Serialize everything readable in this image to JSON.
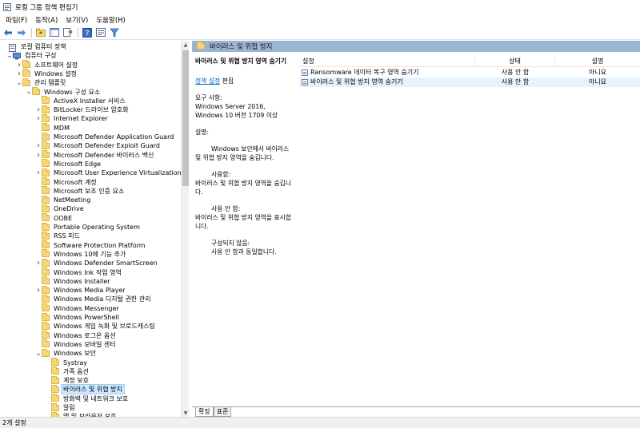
{
  "window": {
    "title": "로컬 그룹 정책 편집기"
  },
  "menu": [
    "파일(F)",
    "동작(A)",
    "보기(V)",
    "도움말(H)"
  ],
  "toolbar": {
    "icons": [
      "back-arrow-icon",
      "forward-arrow-icon",
      "up-folder-icon",
      "show-hide-tree-icon",
      "export-list-icon",
      "help-icon",
      "properties-icon",
      "filter-icon"
    ]
  },
  "tree": [
    {
      "label": "로컬 컴퓨터 정책",
      "indent": 0,
      "exp": "",
      "icon": "policy-icon"
    },
    {
      "label": "컴퓨터 구성",
      "indent": 1,
      "exp": "v",
      "icon": "computer-icon"
    },
    {
      "label": "소프트웨어 설정",
      "indent": 2,
      "exp": ">",
      "icon": "folder-icon"
    },
    {
      "label": "Windows 설정",
      "indent": 2,
      "exp": ">",
      "icon": "folder-icon"
    },
    {
      "label": "관리 템플릿",
      "indent": 2,
      "exp": "v",
      "icon": "folder-icon"
    },
    {
      "label": "Windows 구성 요소",
      "indent": 3,
      "exp": "v",
      "icon": "folder-icon"
    },
    {
      "label": "ActiveX Installer 서비스",
      "indent": 4,
      "exp": "",
      "icon": "folder-icon"
    },
    {
      "label": "BitLocker 드라이브 암호화",
      "indent": 4,
      "exp": ">",
      "icon": "folder-icon"
    },
    {
      "label": "Internet Explorer",
      "indent": 4,
      "exp": ">",
      "icon": "folder-icon"
    },
    {
      "label": "MDM",
      "indent": 4,
      "exp": "",
      "icon": "folder-icon"
    },
    {
      "label": "Microsoft Defender Application Guard",
      "indent": 4,
      "exp": "",
      "icon": "folder-icon"
    },
    {
      "label": "Microsoft Defender Exploit Guard",
      "indent": 4,
      "exp": ">",
      "icon": "folder-icon"
    },
    {
      "label": "Microsoft Defender 바이러스 백신",
      "indent": 4,
      "exp": ">",
      "icon": "folder-icon"
    },
    {
      "label": "Microsoft Edge",
      "indent": 4,
      "exp": "",
      "icon": "folder-icon"
    },
    {
      "label": "Microsoft User Experience Virtualization",
      "indent": 4,
      "exp": ">",
      "icon": "folder-icon"
    },
    {
      "label": "Microsoft 계정",
      "indent": 4,
      "exp": "",
      "icon": "folder-icon"
    },
    {
      "label": "Microsoft 보조 인증 요소",
      "indent": 4,
      "exp": "",
      "icon": "folder-icon"
    },
    {
      "label": "NetMeeting",
      "indent": 4,
      "exp": "",
      "icon": "folder-icon"
    },
    {
      "label": "OneDrive",
      "indent": 4,
      "exp": "",
      "icon": "folder-icon"
    },
    {
      "label": "OOBE",
      "indent": 4,
      "exp": "",
      "icon": "folder-icon"
    },
    {
      "label": "Portable Operating System",
      "indent": 4,
      "exp": "",
      "icon": "folder-icon"
    },
    {
      "label": "RSS 피드",
      "indent": 4,
      "exp": "",
      "icon": "folder-icon"
    },
    {
      "label": "Software Protection Platform",
      "indent": 4,
      "exp": "",
      "icon": "folder-icon"
    },
    {
      "label": "Windows 10에 기능 추가",
      "indent": 4,
      "exp": "",
      "icon": "folder-icon"
    },
    {
      "label": "Windows Defender SmartScreen",
      "indent": 4,
      "exp": ">",
      "icon": "folder-icon"
    },
    {
      "label": "Windows Ink 작업 영역",
      "indent": 4,
      "exp": "",
      "icon": "folder-icon"
    },
    {
      "label": "Windows Installer",
      "indent": 4,
      "exp": "",
      "icon": "folder-icon"
    },
    {
      "label": "Windows Media Player",
      "indent": 4,
      "exp": ">",
      "icon": "folder-icon"
    },
    {
      "label": "Windows Media 디지털 권한 관리",
      "indent": 4,
      "exp": "",
      "icon": "folder-icon"
    },
    {
      "label": "Windows Messenger",
      "indent": 4,
      "exp": "",
      "icon": "folder-icon"
    },
    {
      "label": "Windows PowerShell",
      "indent": 4,
      "exp": "",
      "icon": "folder-icon"
    },
    {
      "label": "Windows 게임 녹화 및 브로드캐스팅",
      "indent": 4,
      "exp": "",
      "icon": "folder-icon"
    },
    {
      "label": "Windows 로그온 옵션",
      "indent": 4,
      "exp": "",
      "icon": "folder-icon"
    },
    {
      "label": "Windows 모바일 센터",
      "indent": 4,
      "exp": "",
      "icon": "folder-icon"
    },
    {
      "label": "Windows 보안",
      "indent": 4,
      "exp": "v",
      "icon": "folder-icon"
    },
    {
      "label": "Systray",
      "indent": 5,
      "exp": "",
      "icon": "folder-icon"
    },
    {
      "label": "가족 옵션",
      "indent": 5,
      "exp": "",
      "icon": "folder-icon"
    },
    {
      "label": "계정 보호",
      "indent": 5,
      "exp": "",
      "icon": "folder-icon"
    },
    {
      "label": "바이러스 및 위협 방지",
      "indent": 5,
      "exp": "",
      "icon": "folder-icon",
      "selected": true
    },
    {
      "label": "방화벽 및 네트워크 보호",
      "indent": 5,
      "exp": "",
      "icon": "folder-icon"
    },
    {
      "label": "알림",
      "indent": 5,
      "exp": "",
      "icon": "folder-icon"
    },
    {
      "label": "앱 및 브라우저 보호",
      "indent": 5,
      "exp": "",
      "icon": "folder-icon"
    }
  ],
  "right_pane": {
    "header": "바이러스 및 위협 방지",
    "description": {
      "title": "바이러스 및 위협 방지 영역 숨기기",
      "edit_link": "정책 설정",
      "edit_suffix": " 편집",
      "requirements_label": "요구 사항:",
      "requirements": "Windows Server 2016, Windows 10 버전 1709 이상",
      "description_label": "설명:",
      "description_text": "Windows 보안에서 바이러스 및 위협 방지 영역을 숨깁니다.",
      "enabled_label": "사용함:",
      "enabled_text": "바이러스 및 위협 방지 영역을 숨깁니다.",
      "disabled_label": "사용 안 함:",
      "disabled_text": "바이러스 및 위협 방지 영역을 표시합니다.",
      "notconfigured_label": "구성되지 않음:",
      "notconfigured_text": "사용 안 함과 동일합니다."
    },
    "columns": [
      "설정",
      "상태",
      "설명"
    ],
    "rows": [
      {
        "setting": "Ransomware 데이터 복구 영역 숨기기",
        "state": "사용 안 함",
        "comment": "아니요"
      },
      {
        "setting": "바이러스 및 위협 방지 영역 숨기기",
        "state": "사용 안 함",
        "comment": "아니요",
        "selected": true
      }
    ],
    "tabs": [
      "확장",
      "표준"
    ]
  },
  "status": {
    "text": "2개 설정"
  }
}
